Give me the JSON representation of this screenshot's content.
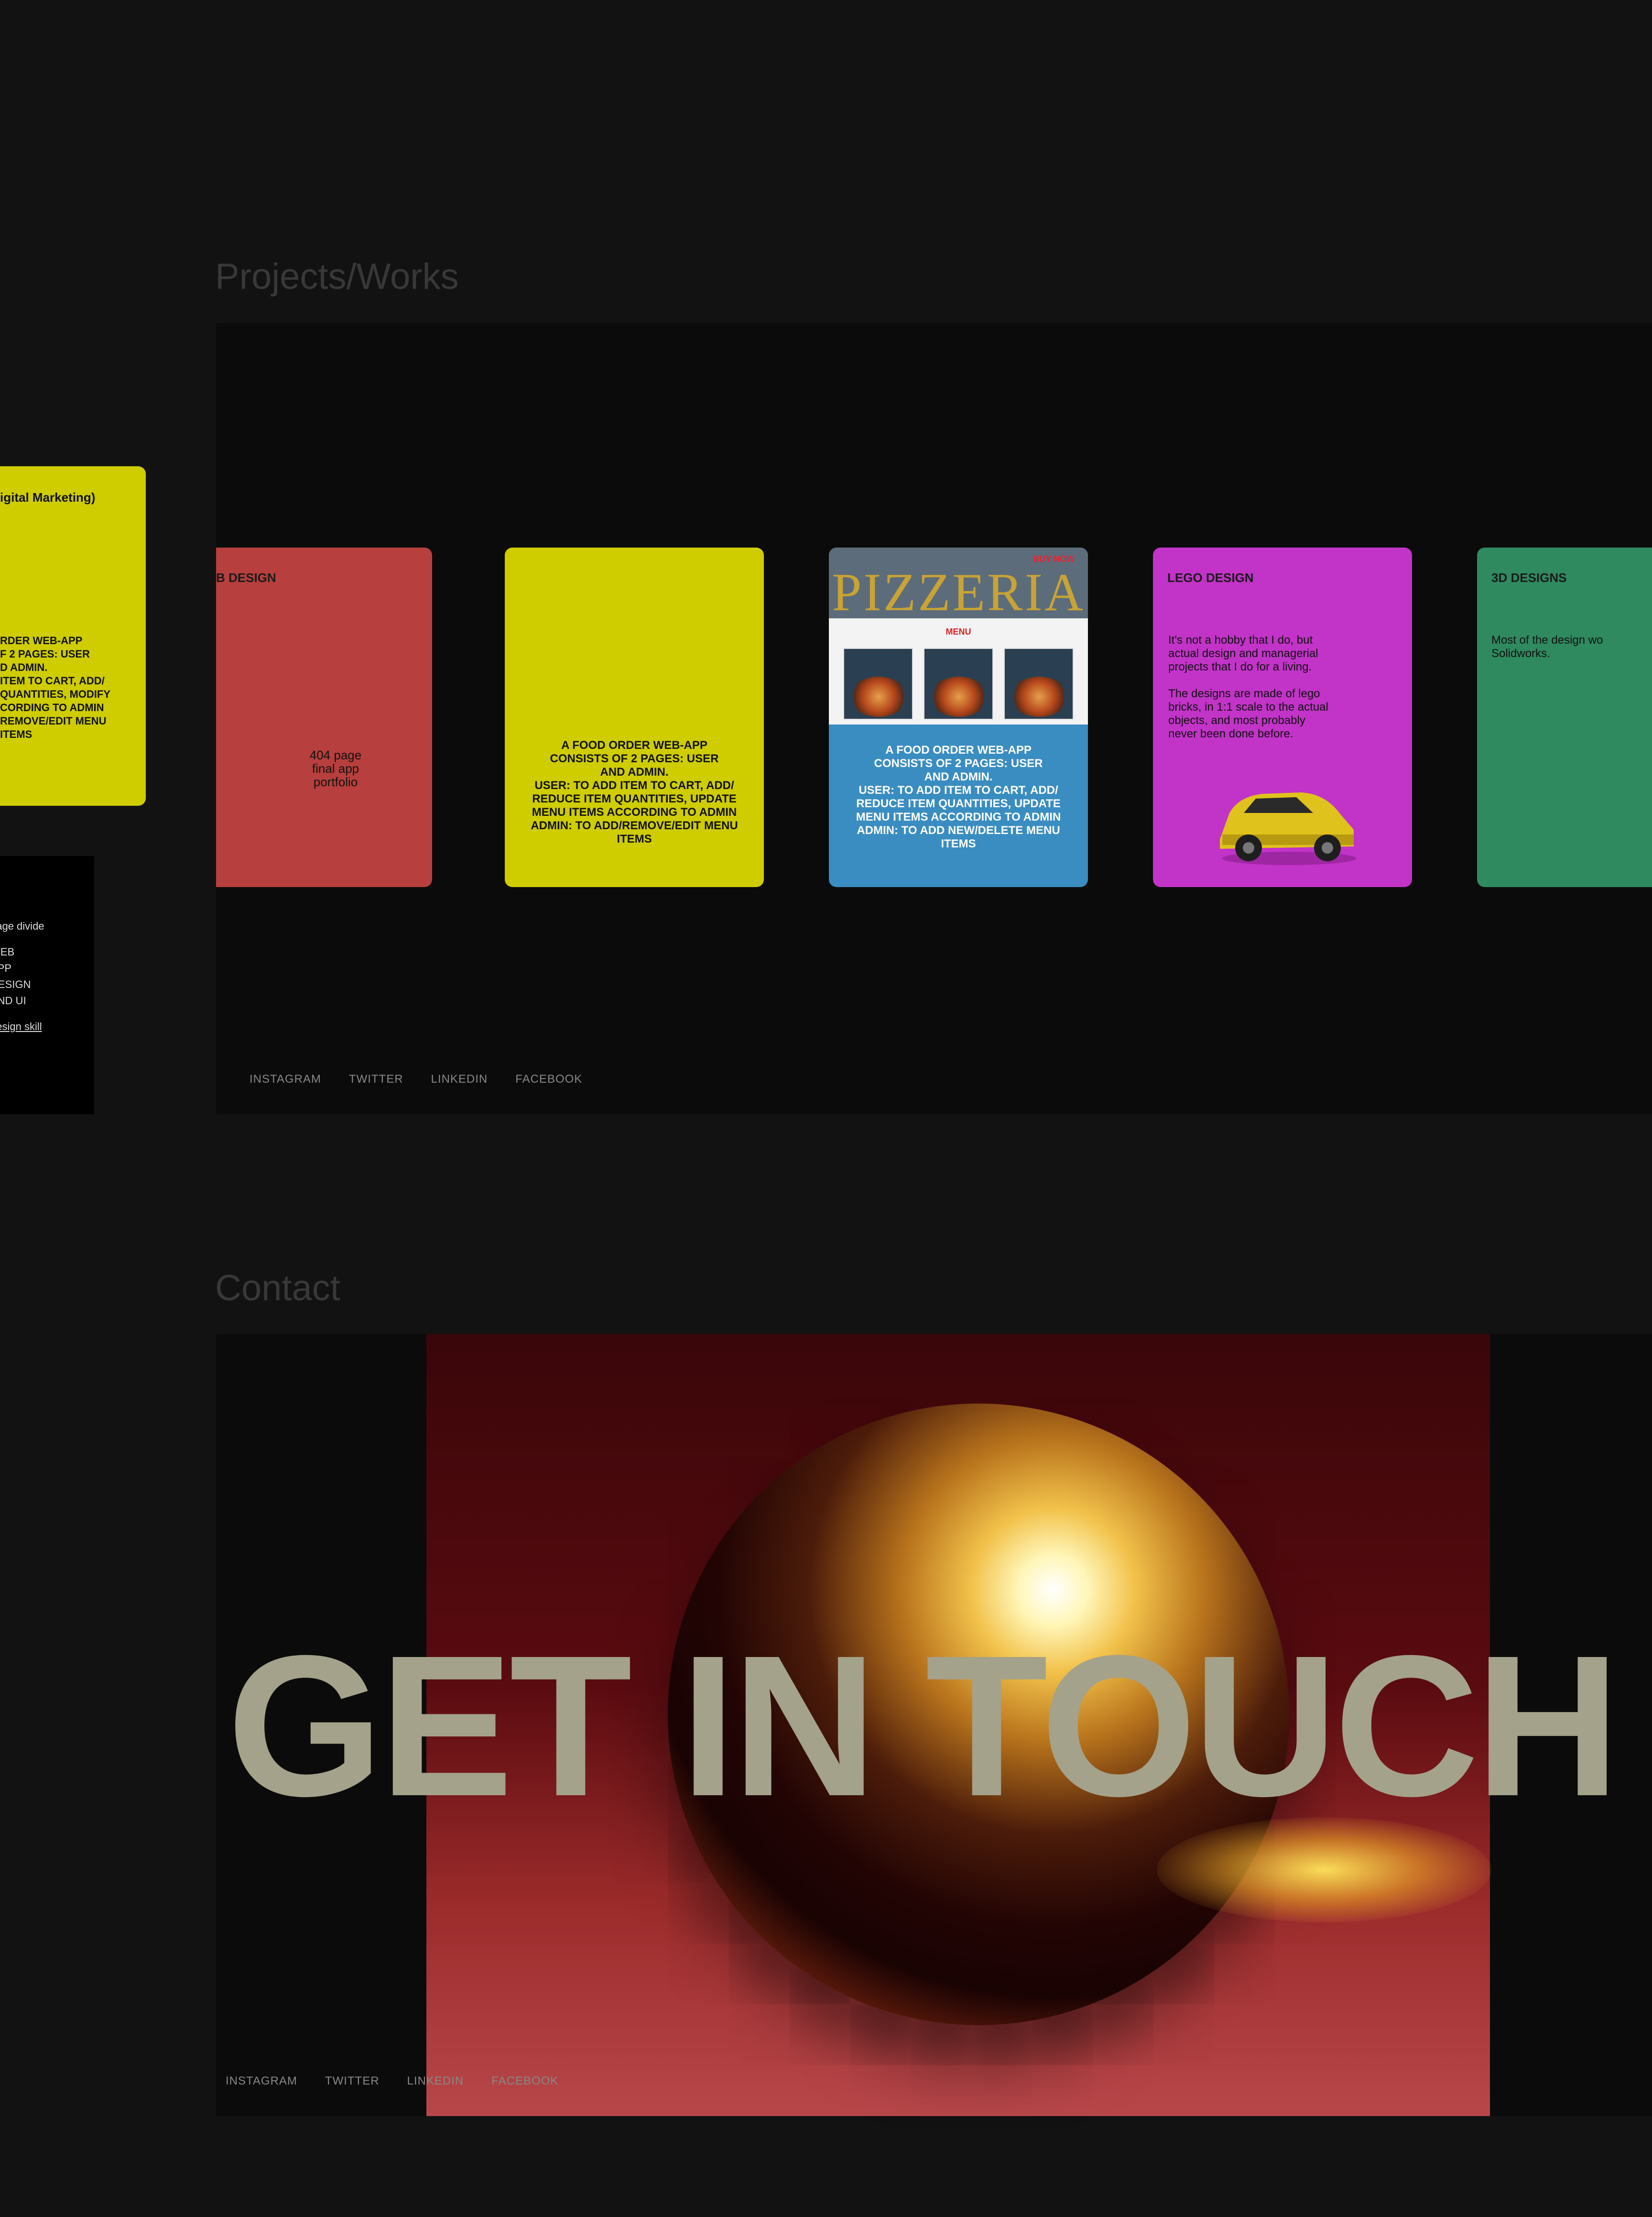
{
  "left_partial": {
    "yellow_card": {
      "title": "igital Marketing)",
      "desc": "RDER WEB-APP\nF 2 PAGES: USER\nD ADMIN.\nITEM TO CART, ADD/\nQUANTITIES, MODIFY\nCORDING TO ADMIN\nREMOVE/EDIT MENU\nITEMS"
    },
    "black_panel": {
      "lines": [
        "page divide",
        "",
        "WEB",
        "APP",
        "DESIGN",
        "AND UI"
      ],
      "skill": "design skill"
    }
  },
  "projects": {
    "title": "Projects/Works",
    "cards": [
      {
        "title": "B DESIGN",
        "mid": "404 page\nfinal app\nportfolio",
        "color": "#b73f3d"
      },
      {
        "title": "",
        "desc": "A FOOD ORDER WEB-APP\nCONSISTS OF 2 PAGES: USER\nAND ADMIN.\nUSER: TO ADD ITEM TO CART, ADD/\nREDUCE ITEM QUANTITIES, UPDATE\nMENU ITEMS ACCORDING TO ADMIN\nADMIN: TO ADD/REMOVE/EDIT MENU\nITEMS",
        "color": "#cfcc00"
      },
      {
        "title": "PIZZERIA",
        "menu_label": "MENU",
        "badge": "BUY NOW",
        "desc": "A FOOD ORDER WEB-APP\nCONSISTS OF 2 PAGES: USER\nAND ADMIN.\nUSER: TO ADD ITEM TO CART, ADD/\nREDUCE ITEM QUANTITIES, UPDATE\nMENU ITEMS ACCORDING TO ADMIN\nADMIN: TO ADD NEW/DELETE MENU\nITEMS",
        "color": "#3a8dc1"
      },
      {
        "title": "LEGO DESIGN",
        "desc": "It's not a hobby that I do, but\nactual design and managerial\nprojects that I do for a living.\n\nThe designs are made of lego\nbricks, in 1:1 scale to the actual\nobjects, and most probably\nnever been done before.",
        "color": "#c233c8"
      },
      {
        "title": "3D DESIGNS",
        "desc": "Most of the design wo\nSolidworks.",
        "color": "#2f8a5f"
      }
    ],
    "social": [
      "INSTAGRAM",
      "TWITTER",
      "LINKEDIN",
      "FACEBOOK"
    ]
  },
  "contact": {
    "title": "Contact",
    "headline": "GET IN TOUCH",
    "social": [
      "INSTAGRAM",
      "TWITTER",
      "LINKEDIN",
      "FACEBOOK"
    ]
  }
}
